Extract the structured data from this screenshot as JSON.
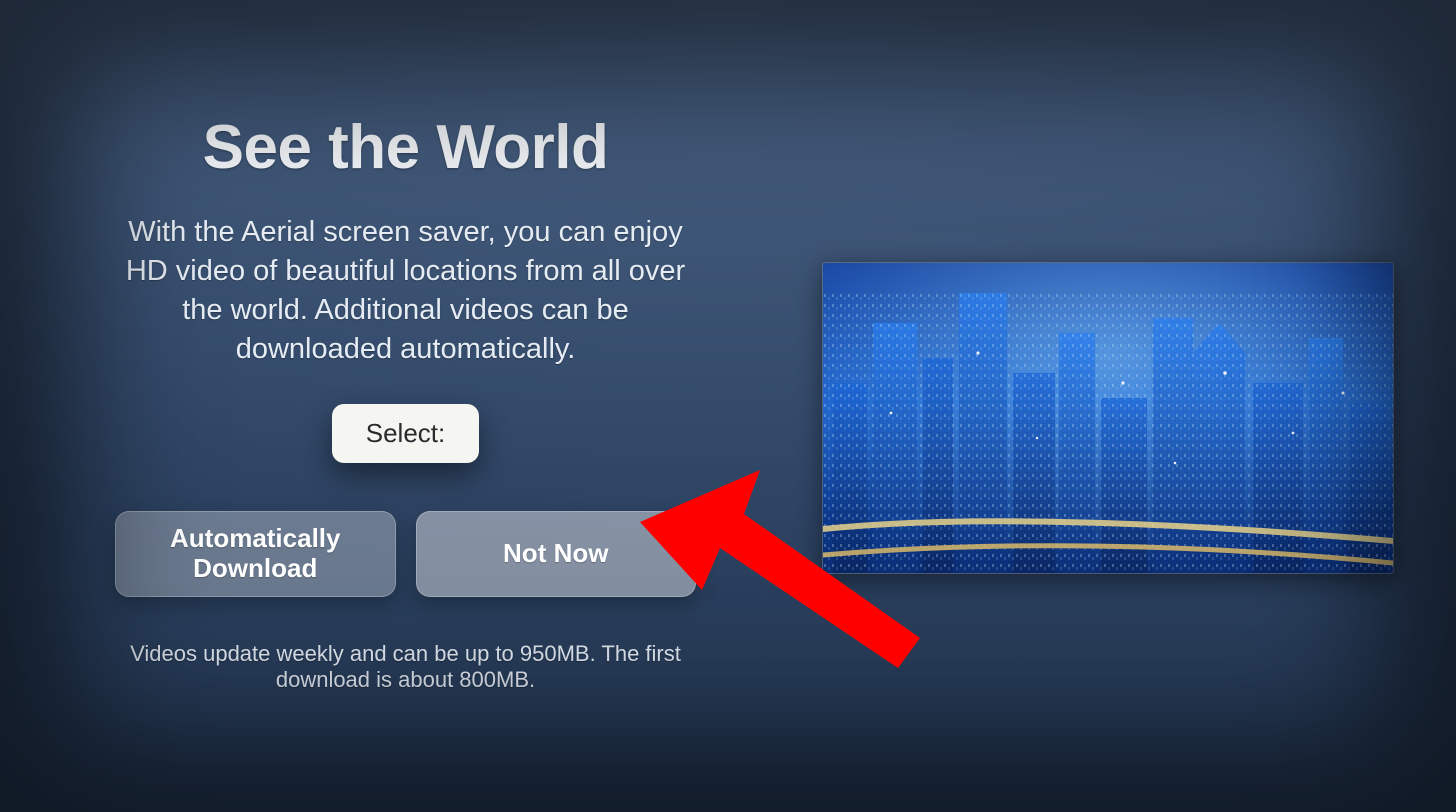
{
  "title": "See the World",
  "description": "With the Aerial screen saver, you can enjoy HD video of beautiful locations from all over the world. Additional videos can be downloaded automatically.",
  "select_label": "Select:",
  "buttons": {
    "auto": "Automatically Download",
    "not_now": "Not Now"
  },
  "footnote": "Videos update weekly and can be up to 950MB. The first download is about 800MB.",
  "preview_alt": "Aerial night cityscape preview",
  "annotation": "arrow pointing to Not Now button"
}
